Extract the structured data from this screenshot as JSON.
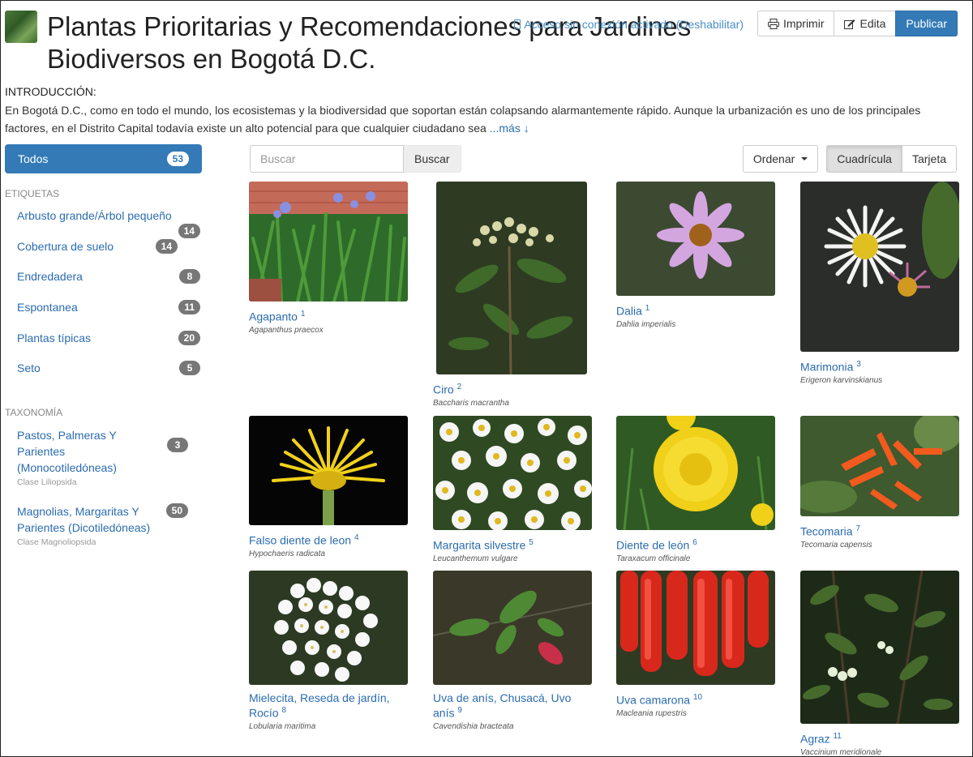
{
  "header": {
    "title": "Plantas Prioritarias y Recomendaciones para Jardines Biodiversos en Bogotá D.C.",
    "offline_text": "Acceso sin conexión activado (Deshabilitar)",
    "buttons": {
      "print": "Imprimir",
      "edit": "Edita",
      "publish": "Publicar"
    }
  },
  "intro": {
    "label": "INTRODUCCIÓN:",
    "text": "En Bogotá D.C., como en todo el mundo, los ecosistemas y la biodiversidad que soportan están colapsando alarmantemente rápido. Aunque la urbanización es uno de los principales factores, en el Distrito Capital todavía existe un alto potencial para que cualquier ciudadano sea ",
    "more": "...más ↓"
  },
  "sidebar": {
    "all": {
      "label": "Todos",
      "count": "53"
    },
    "tags_heading": "ETIQUETAS",
    "tags": [
      {
        "label": "Arbusto grande/Árbol pequeño",
        "count": "14"
      },
      {
        "label": "Cobertura de suelo",
        "count": "14"
      },
      {
        "label": "Endredadera",
        "count": "8"
      },
      {
        "label": "Espontanea",
        "count": "11"
      },
      {
        "label": "Plantas típicas",
        "count": "20"
      },
      {
        "label": "Seto",
        "count": "5"
      }
    ],
    "taxonomy_heading": "TAXONOMÍA",
    "taxonomy": [
      {
        "label": "Pastos, Palmeras Y Parientes (Monocotiledóneas)",
        "sub": "Clase Liliopsida",
        "count": "3"
      },
      {
        "label": "Magnolias, Margaritas Y Parientes (Dicotiledóneas)",
        "sub": "Clase Magnoliopsida",
        "count": "50"
      }
    ]
  },
  "toolbar": {
    "search_placeholder": "Buscar",
    "search_button": "Buscar",
    "sort": "Ordenar",
    "grid": "Cuadrícula",
    "card": "Tarjeta"
  },
  "plants": [
    {
      "name": "Agapanto",
      "num": "1",
      "sci": "Agapanthus praecox"
    },
    {
      "name": "Ciro",
      "num": "2",
      "sci": "Baccharis macrantha"
    },
    {
      "name": "Dalia",
      "num": "1",
      "sci": "Dahlia imperialis"
    },
    {
      "name": "Marimonia",
      "num": "3",
      "sci": "Erigeron karvinskianus"
    },
    {
      "name": "Falso diente de leon",
      "num": "4",
      "sci": "Hypochaeris radicata"
    },
    {
      "name": "Margarita silvestre",
      "num": "5",
      "sci": "Leucanthemum vulgare"
    },
    {
      "name": "Diente de león",
      "num": "6",
      "sci": "Taraxacum officinale"
    },
    {
      "name": "Tecomaria",
      "num": "7",
      "sci": "Tecomaria capensis"
    },
    {
      "name": "Mielecita, Reseda de jardín, Rocío",
      "num": "8",
      "sci": "Lobularia maritima"
    },
    {
      "name": "Uva de anís, Chusacá, Uvo anís",
      "num": "9",
      "sci": "Cavendishia bracteata"
    },
    {
      "name": "Uva camarona",
      "num": "10",
      "sci": "Macleania rupestris"
    },
    {
      "name": "Agraz",
      "num": "11",
      "sci": "Vaccinium meridionale"
    }
  ]
}
